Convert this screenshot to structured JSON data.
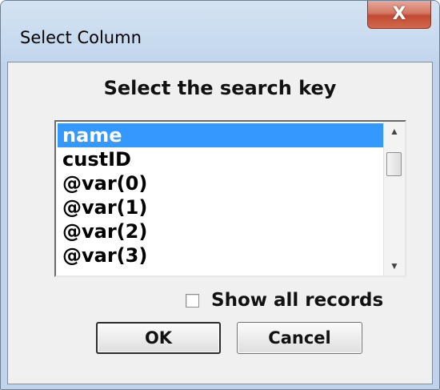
{
  "window": {
    "title": "Select Column",
    "close_label": "X"
  },
  "dialog": {
    "heading": "Select the search key",
    "list": {
      "items": [
        "name",
        "custID",
        "@var(0)",
        "@var(1)",
        "@var(2)",
        "@var(3)"
      ],
      "selected": "name"
    },
    "scrollbar": {
      "up_arrow": "▲",
      "down_arrow": "▼"
    },
    "checkbox": {
      "label": "Show all records",
      "checked": false
    },
    "buttons": {
      "ok": "OK",
      "cancel": "Cancel"
    }
  }
}
